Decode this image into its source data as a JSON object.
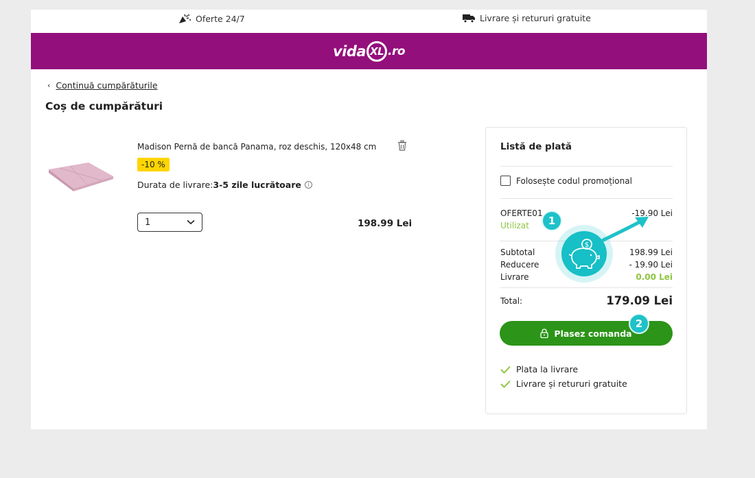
{
  "topbar": {
    "offers_label": "Oferte 24/7",
    "shipping_label": "Livrare și retururi gratuite"
  },
  "brand": {
    "logo_text_left": "vida",
    "logo_text_mid": "XL",
    "logo_text_right": ".ro",
    "bar_color": "#930f7c"
  },
  "nav": {
    "back_label": "Continuă cumpărăturile"
  },
  "page_title": "Coș de cumpărături",
  "cart": {
    "items": [
      {
        "name": "Madison Pernă de bancă Panama, roz deschis, 120x48 cm",
        "discount_badge": "-10 %",
        "delivery_label": "Durata de livrare:",
        "delivery_value": "3-5 zile lucrătoare",
        "quantity": "1",
        "price": "198.99 Lei"
      }
    ]
  },
  "summary": {
    "title": "Listă de plată",
    "promo_label": "Folosește codul promoțional",
    "promo_code": "OFERTE01",
    "promo_status": "Utilizat",
    "promo_amount": "-19.90 Lei",
    "subtotal_label": "Subtotal",
    "subtotal_value": "198.99 Lei",
    "discount_label": "Reducere",
    "discount_value": "- 19.90 Lei",
    "shipping_label": "Livrare",
    "shipping_value": "0.00 Lei",
    "total_label": "Total:",
    "total_value": "179.09 Lei",
    "order_button": "Plasez comanda",
    "benefits": [
      "Plata la livrare",
      "Livrare și retururi gratuite"
    ]
  },
  "overlay": {
    "badge_1": "1",
    "badge_2": "2",
    "accent_color": "#1ec2c8"
  },
  "colors": {
    "button_green": "#2c9418",
    "text_green": "#8dc63f",
    "badge_yellow": "#ffd500"
  }
}
